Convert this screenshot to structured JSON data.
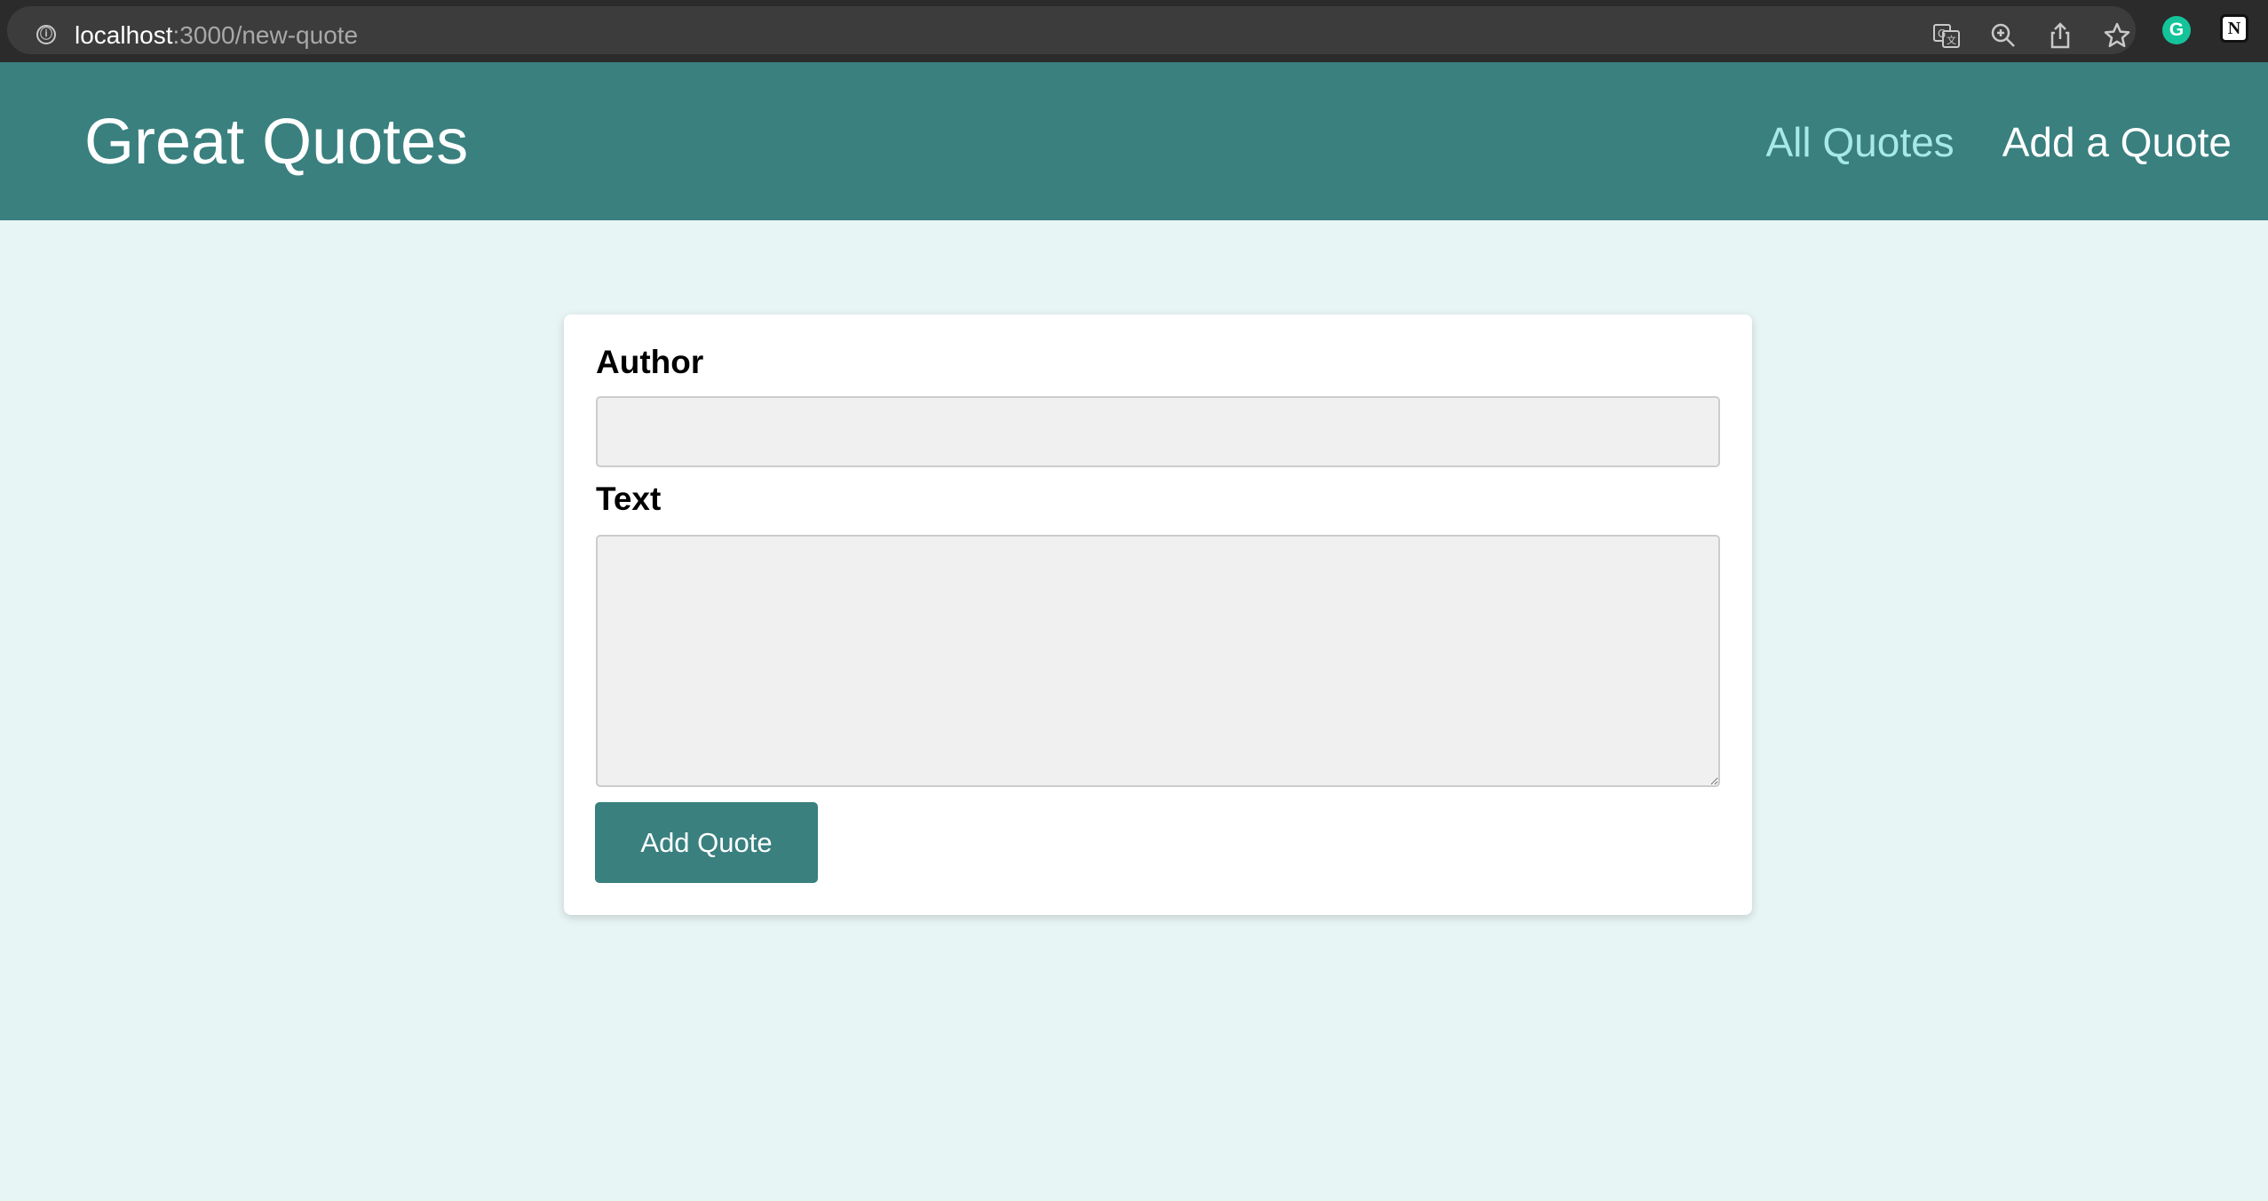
{
  "browser": {
    "url_host": "localhost",
    "url_path": ":3000/new-quote",
    "info_icon": "ⓘ",
    "icons": [
      "translate-icon",
      "zoom-icon",
      "share-icon",
      "bookmark-star-icon"
    ],
    "extensions": [
      {
        "name": "grammarly-extension-icon",
        "glyph": "G",
        "color": "#15c39a"
      },
      {
        "name": "notion-extension-icon",
        "glyph": "N",
        "color": "#111111"
      }
    ]
  },
  "header": {
    "title": "Great Quotes",
    "nav": [
      {
        "label": "All Quotes",
        "active": true
      },
      {
        "label": "Add a Quote",
        "active": false
      }
    ]
  },
  "form": {
    "author_label": "Author",
    "author_value": "",
    "text_label": "Text",
    "text_value": "",
    "submit_label": "Add Quote"
  },
  "colors": {
    "primary": "#39807f",
    "active_nav": "#a7e9e6",
    "page_background": "#e8f5f5",
    "input_background": "#f0f0f0"
  }
}
